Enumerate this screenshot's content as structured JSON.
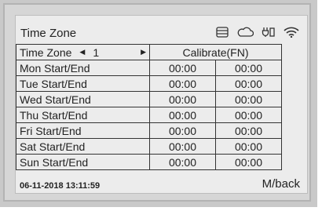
{
  "header": {
    "title": "Time Zone",
    "icons": [
      "storage-icon",
      "cloud-icon",
      "plug-icon",
      "wifi-icon"
    ]
  },
  "table": {
    "header": {
      "label": "Time Zone",
      "left_arrow": "◀",
      "value": "1",
      "right_arrow": "▶",
      "calibrate": "Calibrate(FN)"
    },
    "rows": [
      {
        "label": "Mon Start/End",
        "start": "00:00",
        "end": "00:00"
      },
      {
        "label": "Tue Start/End",
        "start": "00:00",
        "end": "00:00"
      },
      {
        "label": "Wed Start/End",
        "start": "00:00",
        "end": "00:00"
      },
      {
        "label": "Thu Start/End",
        "start": "00:00",
        "end": "00:00"
      },
      {
        "label": "Fri Start/End",
        "start": "00:00",
        "end": "00:00"
      },
      {
        "label": "Sat Start/End",
        "start": "00:00",
        "end": "00:00"
      },
      {
        "label": "Sun Start/End",
        "start": "00:00",
        "end": "00:00"
      }
    ]
  },
  "footer": {
    "datetime": "06-11-2018  13:11:59",
    "back": "M/back"
  }
}
